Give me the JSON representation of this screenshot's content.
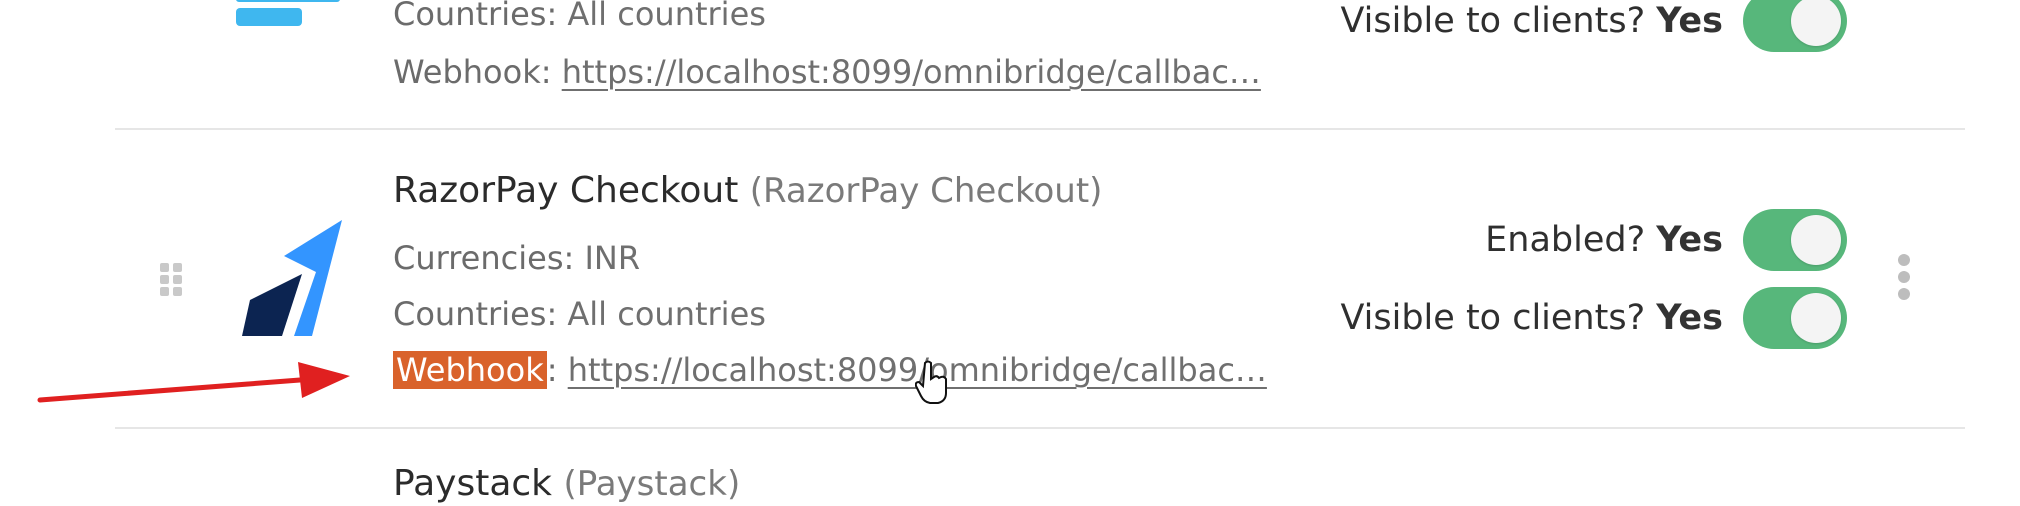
{
  "rows": [
    {
      "countries_label": "Countries:",
      "countries_value": "All countries",
      "webhook_label": "Webhook:",
      "webhook_value": "https://localhost:8099/omnibridge/callbac…",
      "visible_label": "Visible to clients?",
      "visible_value": "Yes",
      "visible_on": true
    },
    {
      "name": "RazorPay Checkout",
      "alias": "(RazorPay Checkout)",
      "currencies_label": "Currencies:",
      "currencies_value": "INR",
      "countries_label": "Countries:",
      "countries_value": "All countries",
      "webhook_label": "Webhook",
      "webhook_colon": ":",
      "webhook_value": "https://localhost:8099/omnibridge/callbac…",
      "enabled_label": "Enabled?",
      "enabled_value": "Yes",
      "enabled_on": true,
      "visible_label": "Visible to clients?",
      "visible_value": "Yes",
      "visible_on": true
    },
    {
      "name": "Paystack",
      "alias": "(Paystack)"
    }
  ],
  "colors": {
    "toggle_on": "#57b77b",
    "highlight": "#d9622b",
    "annotation_arrow": "#e02020",
    "razorpay_logo_dark": "#0c2451",
    "razorpay_logo_light": "#3395ff"
  }
}
